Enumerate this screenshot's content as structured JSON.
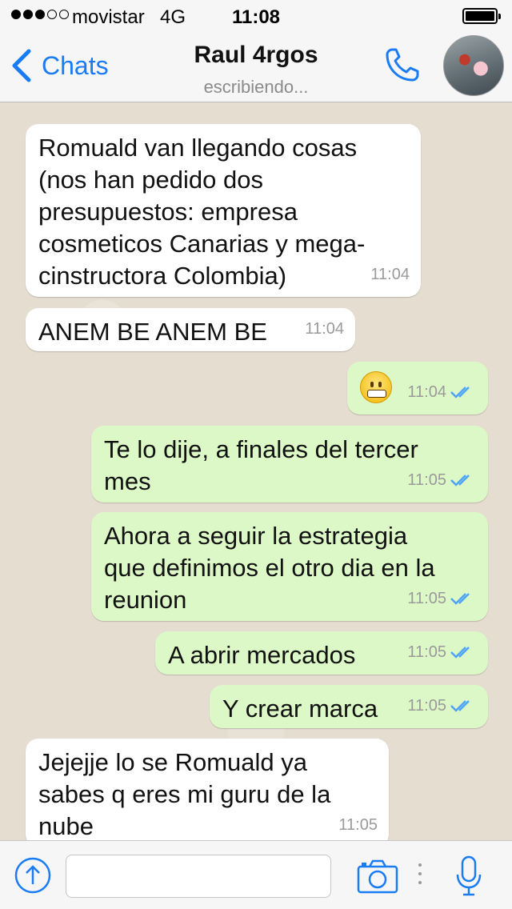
{
  "status_bar": {
    "signal_dots_filled": 3,
    "signal_dots_total": 5,
    "carrier": "movistar",
    "network": "4G",
    "time": "11:08",
    "battery_level": 1.0
  },
  "header": {
    "back_label": "Chats",
    "contact_name": "Raul 4rgos",
    "contact_status": "escribiendo...",
    "icons": {
      "back": "chevron-left-icon",
      "call": "phone-icon",
      "avatar": "contact-avatar"
    }
  },
  "messages": [
    {
      "direction": "in",
      "text": "Romuald van llegando cosas\n(nos han pedido dos\npresupuestos: empresa\ncosmeticos Canarias y mega-\ncinstructora Colombia)",
      "time": "11:04"
    },
    {
      "direction": "in",
      "text": "ANEM BE ANEM BE",
      "time": "11:04"
    },
    {
      "direction": "out",
      "text": "",
      "emoji": "grimacing-face",
      "time": "11:04",
      "read": true
    },
    {
      "direction": "out",
      "text": "Te lo dije, a finales del tercer\nmes",
      "time": "11:05",
      "read": true
    },
    {
      "direction": "out",
      "text": "Ahora a seguir la estrategia\nque definimos el otro dia en la\nreunion",
      "time": "11:05",
      "read": true
    },
    {
      "direction": "out",
      "text": "A abrir mercados",
      "time": "11:05",
      "read": true
    },
    {
      "direction": "out",
      "text": "Y crear marca",
      "time": "11:05",
      "read": true
    },
    {
      "direction": "in",
      "text": "Jejejje lo se Romuald ya\nsabes q eres mi guru de la\nnube",
      "time": "11:05"
    }
  ],
  "input_bar": {
    "placeholder": "",
    "value": "",
    "icons": [
      "share-upload-icon",
      "camera-icon",
      "more-dots-icon",
      "microphone-icon"
    ]
  },
  "colors": {
    "accent": "#1a7cf5",
    "incoming_bubble": "#ffffff",
    "outgoing_bubble": "#dcf8c6",
    "read_ticks": "#4fa3f7",
    "chat_background": "#e4ddd0"
  }
}
